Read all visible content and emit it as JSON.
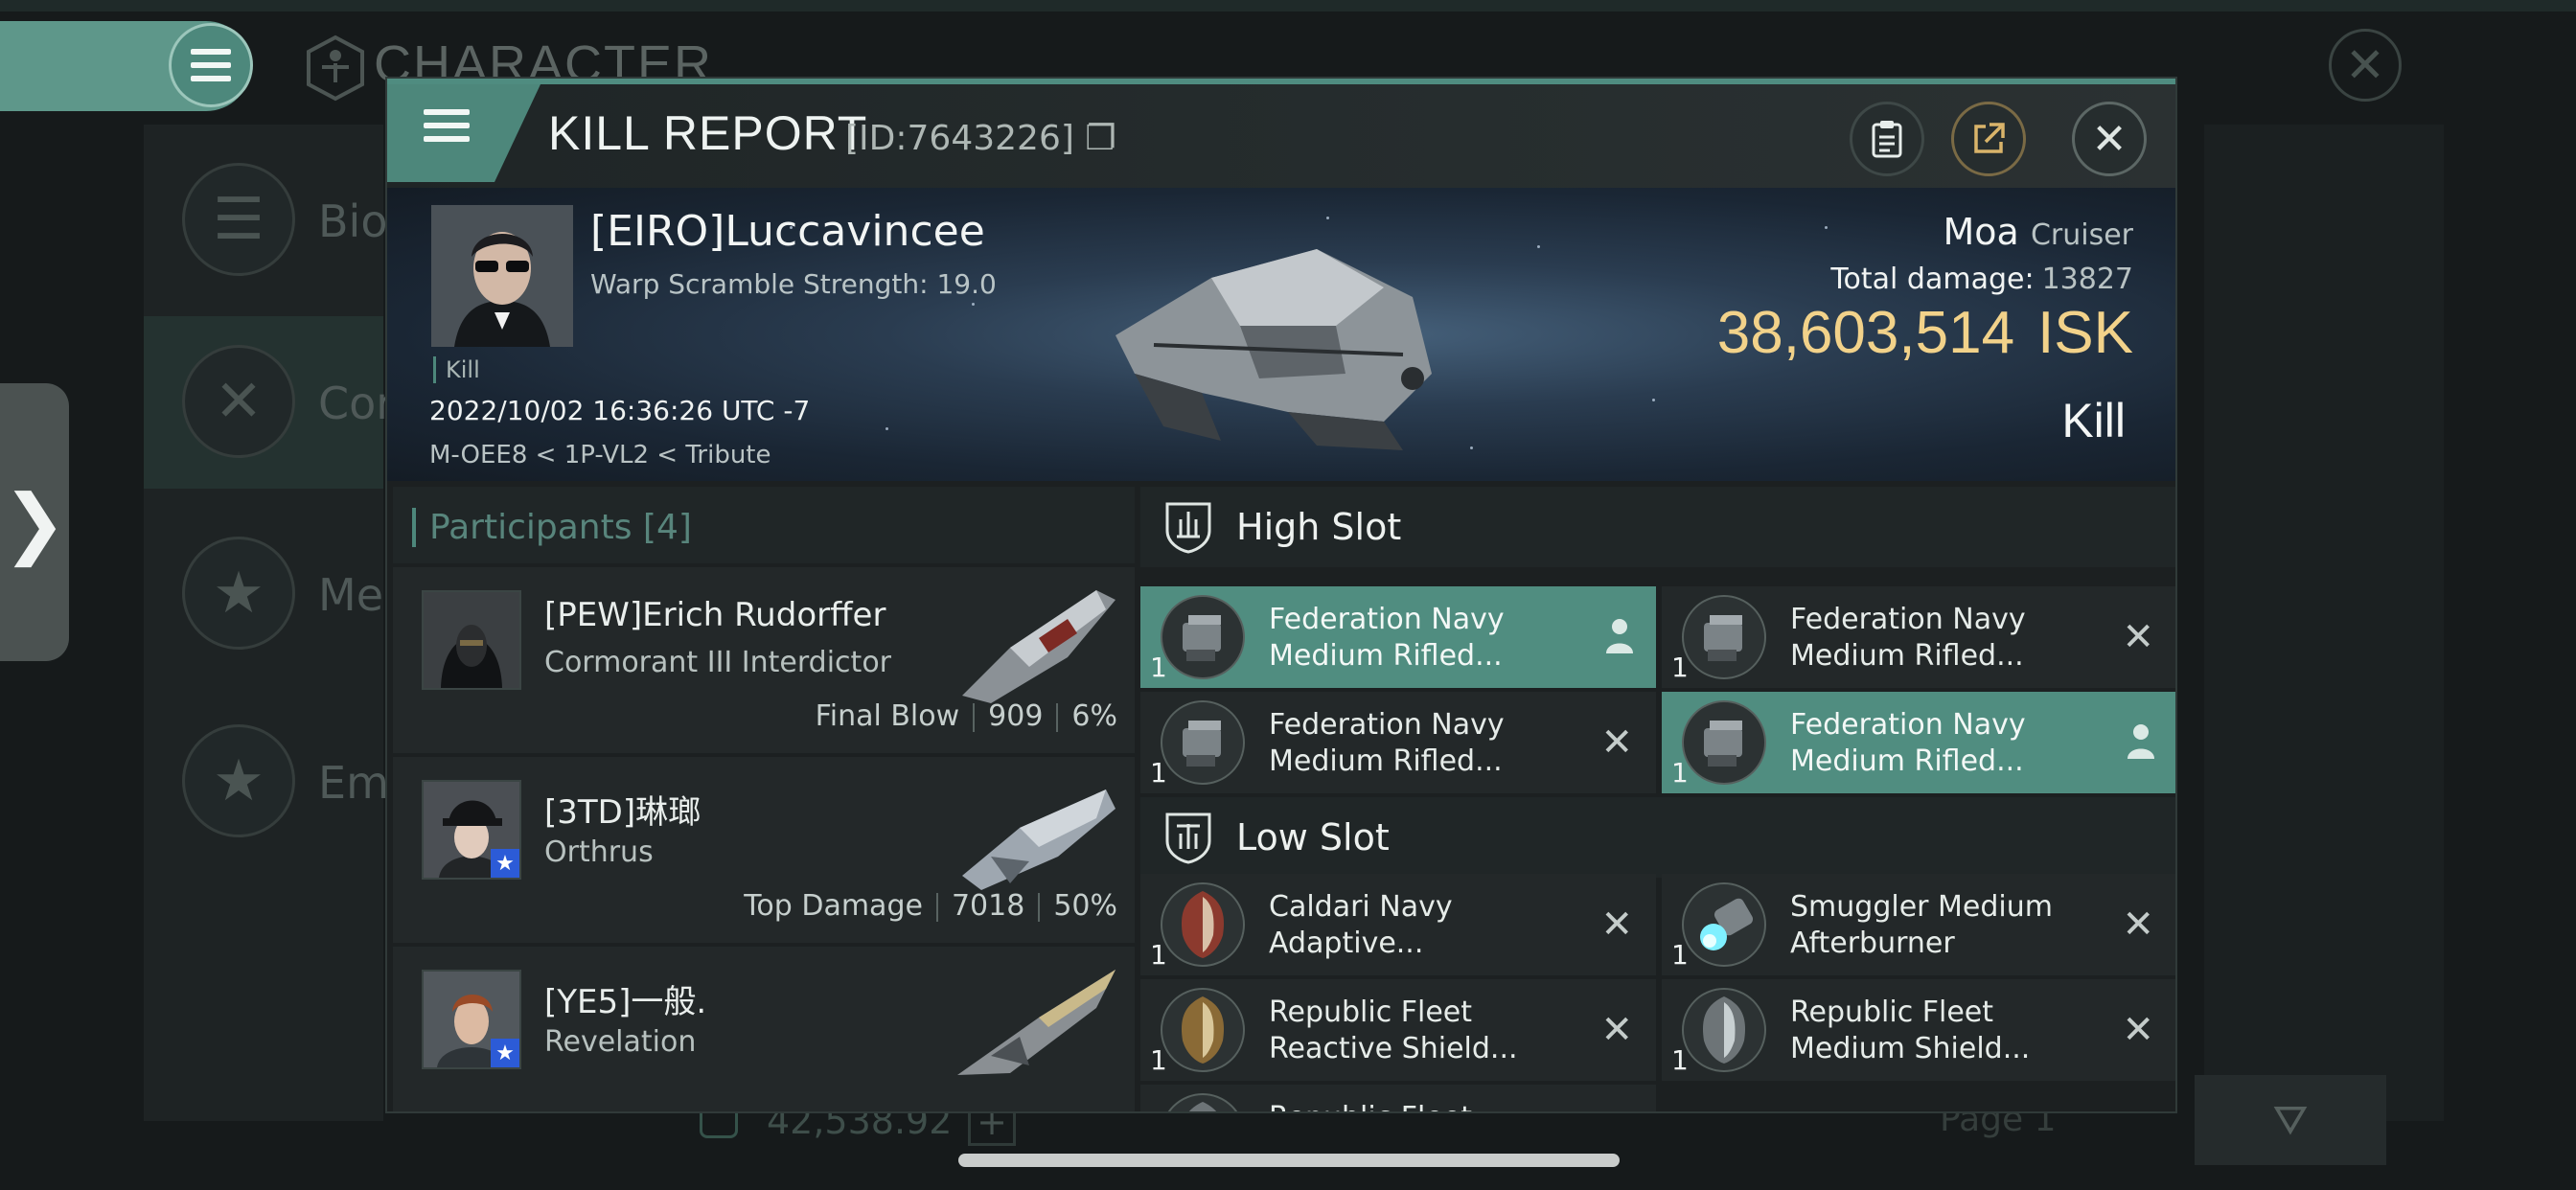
{
  "background": {
    "screen_title": "CHARACTER",
    "sidebar": [
      {
        "label": "Bio",
        "icon": "menu-lines-icon"
      },
      {
        "label": "Cor",
        "icon": "crossed-swords-icon"
      },
      {
        "label": "Me",
        "icon": "star-shield-icon"
      },
      {
        "label": "Em",
        "icon": "star-emblem-icon"
      }
    ],
    "isk_balance": "42,538.92",
    "page_label": "Page 1",
    "expand_glyph": "❯"
  },
  "modal": {
    "title": "KILL REPORT",
    "id_label": "[ID:7643226]",
    "copy_glyph": "❐",
    "close_glyph": "✕"
  },
  "victim": {
    "name": "[EIRO]Luccavincee",
    "warp_scramble": "Warp Scramble Strength: 19.0",
    "tag": "Kill",
    "datetime": "2022/10/02 16:36:26 UTC -7",
    "location": "M-OEE8 < 1P-VL2 < Tribute",
    "ship_name": "Moa",
    "ship_class": "Cruiser",
    "total_damage_label": "Total damage:",
    "total_damage": "13827",
    "isk_value": "38,603,514",
    "isk_unit": "ISK",
    "result": "Kill"
  },
  "participants": {
    "title": "Participants",
    "count": "[4]",
    "rows": [
      {
        "name": "[PEW]Erich Rudorffer",
        "ship": "Cormorant III Interdictor",
        "stat_label": "Final Blow",
        "damage": "909",
        "percent": "6%"
      },
      {
        "name": "[3TD]琳瑯",
        "ship": "Orthrus",
        "stat_label": "Top Damage",
        "damage": "7018",
        "percent": "50%"
      },
      {
        "name": "[YE5]一般.",
        "ship": "Revelation",
        "stat_label": "",
        "damage": "",
        "percent": ""
      }
    ]
  },
  "slots": {
    "high": {
      "title": "High Slot",
      "modules": [
        {
          "qty": "1",
          "line1": "Federation Navy",
          "line2": "Medium Rifled...",
          "highlighted": true
        },
        {
          "qty": "1",
          "line1": "Federation Navy",
          "line2": "Medium Rifled...",
          "highlighted": false
        },
        {
          "qty": "1",
          "line1": "Federation Navy",
          "line2": "Medium Rifled...",
          "highlighted": false
        },
        {
          "qty": "1",
          "line1": "Federation Navy",
          "line2": "Medium Rifled...",
          "highlighted": true
        }
      ]
    },
    "low": {
      "title": "Low Slot",
      "modules": [
        {
          "qty": "1",
          "line1": "Caldari Navy",
          "line2": "Adaptive...",
          "highlighted": false
        },
        {
          "qty": "1",
          "line1": "Smuggler Medium",
          "line2": "Afterburner",
          "highlighted": false
        },
        {
          "qty": "1",
          "line1": "Republic Fleet",
          "line2": "Reactive Shield...",
          "highlighted": false
        },
        {
          "qty": "1",
          "line1": "Republic Fleet",
          "line2": "Medium Shield...",
          "highlighted": false
        },
        {
          "qty": "",
          "line1": "Republic Fleet",
          "line2": "",
          "highlighted": false
        }
      ]
    },
    "remove_glyph": "✕"
  },
  "colors": {
    "accent": "#508d80",
    "isk_gold": "#f2d28a",
    "panel": "#232829"
  }
}
